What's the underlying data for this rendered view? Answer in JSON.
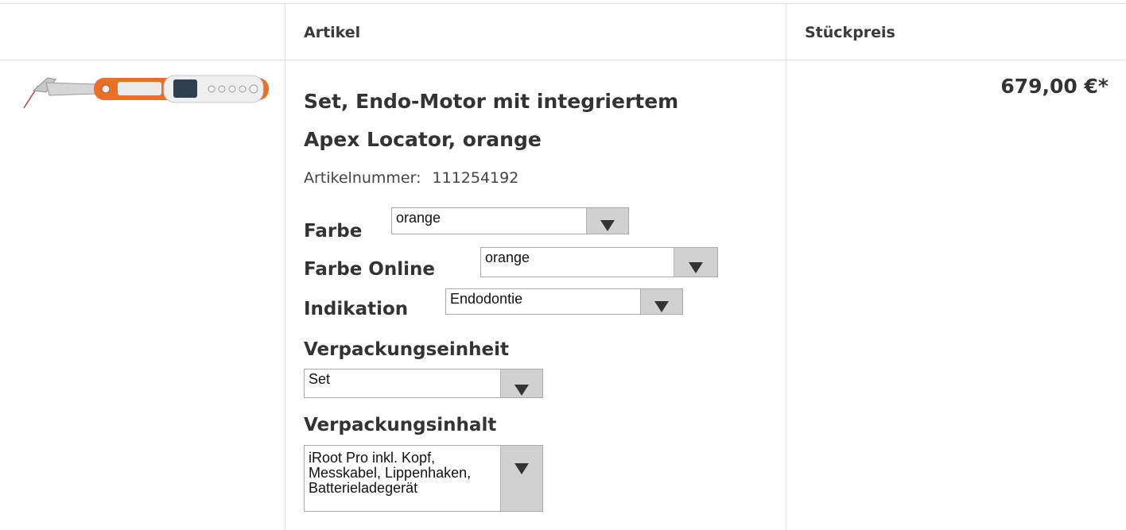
{
  "table": {
    "header": {
      "article_label": "Artikel",
      "unit_price_label": "Stückpreis"
    }
  },
  "product": {
    "image_icon": "endo-motor-handpiece-icon",
    "title_line1": "Set, Endo-Motor mit integriertem",
    "title_line2": "Apex Locator, orange",
    "article_number_label": "Artikelnummer:",
    "article_number": "111254192",
    "price": "679,00 €*",
    "options": {
      "farbe": {
        "label": "Farbe",
        "value": "orange"
      },
      "farbe_online": {
        "label": "Farbe Online",
        "value": "orange"
      },
      "indikation": {
        "label": "Indikation",
        "value": "Endodontie"
      },
      "verpackungseinheit": {
        "label": "Verpackungseinheit",
        "value": "Set"
      },
      "verpackungsinhalt": {
        "label": "Verpackungsinhalt",
        "value_line1": "iRoot Pro inkl. Kopf,",
        "value_line2": "Messkabel, Lippenhaken,",
        "value_line3": "Batterieladegerät"
      }
    }
  },
  "colors": {
    "accent_orange": "#e8702a",
    "border": "#e2e2e2",
    "select_button": "#d1d1d1"
  }
}
